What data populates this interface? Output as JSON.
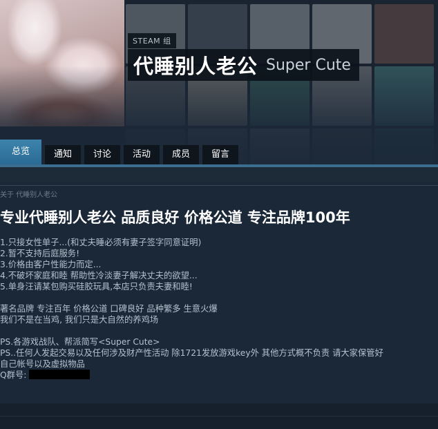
{
  "header": {
    "tag": "STEAM 组",
    "group_name": "代睡别人老公",
    "abbreviation": "Super Cute"
  },
  "tabs": [
    {
      "label": "总览",
      "active": true
    },
    {
      "label": "通知",
      "active": false
    },
    {
      "label": "讨论",
      "active": false
    },
    {
      "label": "活动",
      "active": false
    },
    {
      "label": "成员",
      "active": false
    },
    {
      "label": "留言",
      "active": false
    }
  ],
  "about": {
    "label": "关于 代睡别人老公",
    "headline": "专业代睡别人老公 品质良好 价格公道 专注品牌100年",
    "lines": [
      "1.只接女性单子...(和丈夫睡必须有妻子签字同意证明)",
      "2.暂不支持后庭服务!",
      "3.价格由客户性能力而定...",
      "4.不破坏家庭和睦 帮助性冷淡妻子解决丈夫的欲望...",
      "5.单身汪请某包购买硅胶玩具,本店只负责夫妻和睦!",
      "",
      "著名品牌 专注百年 价格公道 口碑良好 品种繁多 生意火爆",
      "我们不是在当鸡, 我们只是大自然的养鸡场",
      "",
      "PS.各游戏战队、帮派简写<Super Cute>",
      "PS..任何人发起交易以及任何涉及财产性活动 除1721发放游戏key外 其他方式概不负责 请大家保管好",
      "自己帐号以及虚拟物品"
    ],
    "qq_label": "Q群号:"
  },
  "colors": {
    "background": "#1b2838",
    "tab_active": "#3d84ad",
    "tab_inactive": "#0f151c",
    "accent_bar": "#3a6d8f",
    "headline": "#ffffff",
    "body_text": "#b3c0cb"
  }
}
